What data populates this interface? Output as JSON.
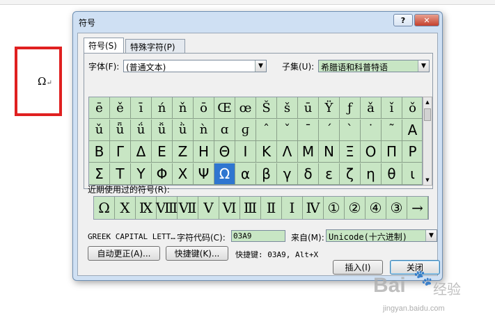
{
  "document": {
    "inserted_char": "Ω",
    "paragraph_mark": "↵"
  },
  "dialog": {
    "title": "符号",
    "help_label": "?",
    "close_label": "✕",
    "tabs": [
      {
        "label": "符号(S)"
      },
      {
        "label": "特殊字符(P)"
      }
    ],
    "font_label": "字体(F):",
    "font_value": "(普通文本)",
    "subset_label": "子集(U):",
    "subset_value": "希腊语和科普特语",
    "grid_rows": [
      [
        "ē",
        "ě",
        "ī",
        "ń",
        "ň",
        "ō",
        "Œ",
        "œ",
        "Š",
        "š",
        "ū",
        "Ÿ",
        "ƒ",
        "ǎ",
        "ǐ",
        "ǒ"
      ],
      [
        "ǔ",
        "ǖ",
        "ǘ",
        "ǚ",
        "ǜ",
        "ǹ",
        "ɑ",
        "ɡ",
        "ˆ",
        "ˇ",
        "ˉ",
        "ˊ",
        "ˋ",
        "˙",
        "˜",
        "Α"
      ],
      [
        "Β",
        "Γ",
        "Δ",
        "Ε",
        "Ζ",
        "Η",
        "Θ",
        "Ι",
        "Κ",
        "Λ",
        "Μ",
        "Ν",
        "Ξ",
        "Ο",
        "Π",
        "Ρ"
      ],
      [
        "Σ",
        "Τ",
        "Υ",
        "Φ",
        "Χ",
        "Ψ",
        "Ω",
        "α",
        "β",
        "γ",
        "δ",
        "ε",
        "ζ",
        "η",
        "θ",
        "ι"
      ]
    ],
    "selected_symbol": "Ω",
    "recent_label": "近期使用过的符号(R):",
    "recent_symbols": [
      "Ω",
      "Ⅹ",
      "Ⅸ",
      "Ⅷ",
      "Ⅶ",
      "Ⅴ",
      "Ⅵ",
      "Ⅲ",
      "Ⅱ",
      "Ⅰ",
      "Ⅳ",
      "①",
      "②",
      "④",
      "③",
      "→"
    ],
    "char_name": "GREEK CAPITAL LETT…",
    "char_code_label": "字符代码(C):",
    "char_code_value": "03A9",
    "from_label": "来自(M):",
    "from_value": "Unicode(十六进制)",
    "autocorrect_label": "自动更正(A)...",
    "shortcut_key_label": "快捷键(K)...",
    "shortcut_text": "快捷键: 03A9, Alt+X",
    "insert_label": "插入(I)",
    "cancel_label": "关闭"
  },
  "watermark": {
    "logo": "Bai",
    "suffix": "经验",
    "url": "jingyan.baidu.com"
  }
}
